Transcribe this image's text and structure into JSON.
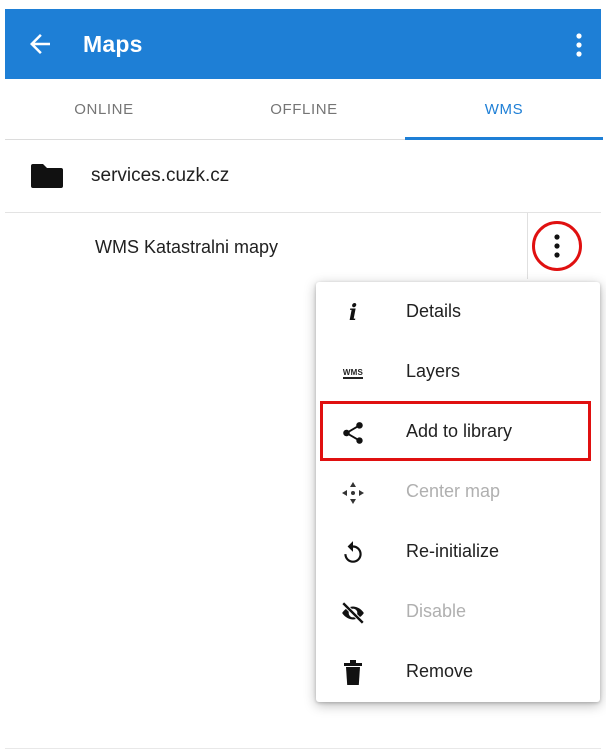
{
  "appbar": {
    "title": "Maps",
    "bg_color": "#1e7fd6",
    "back_icon": "arrow-left-icon",
    "more_icon": "more-vert-icon"
  },
  "tabs": [
    {
      "label": "ONLINE",
      "selected": false
    },
    {
      "label": "OFFLINE",
      "selected": false
    },
    {
      "label": "WMS",
      "selected": true
    }
  ],
  "folder": {
    "label": "services.cuzk.cz",
    "icon": "folder-icon"
  },
  "wms_item": {
    "label": "WMS Katastralni mapy",
    "menu_icon": "more-vert-icon",
    "highlight_color": "#e01010"
  },
  "menu": {
    "items": [
      {
        "label": "Details",
        "icon": "info-icon",
        "enabled": true
      },
      {
        "label": "Layers",
        "icon": "wms-icon",
        "icon_text": "WMS",
        "enabled": true
      },
      {
        "label": "Add to library",
        "icon": "share-icon",
        "enabled": true,
        "highlighted": true
      },
      {
        "label": "Center map",
        "icon": "center-map-icon",
        "enabled": false
      },
      {
        "label": "Re-initialize",
        "icon": "refresh-icon",
        "enabled": true
      },
      {
        "label": "Disable",
        "icon": "eye-off-icon",
        "enabled": false
      },
      {
        "label": "Remove",
        "icon": "trash-icon",
        "enabled": true
      }
    ]
  }
}
